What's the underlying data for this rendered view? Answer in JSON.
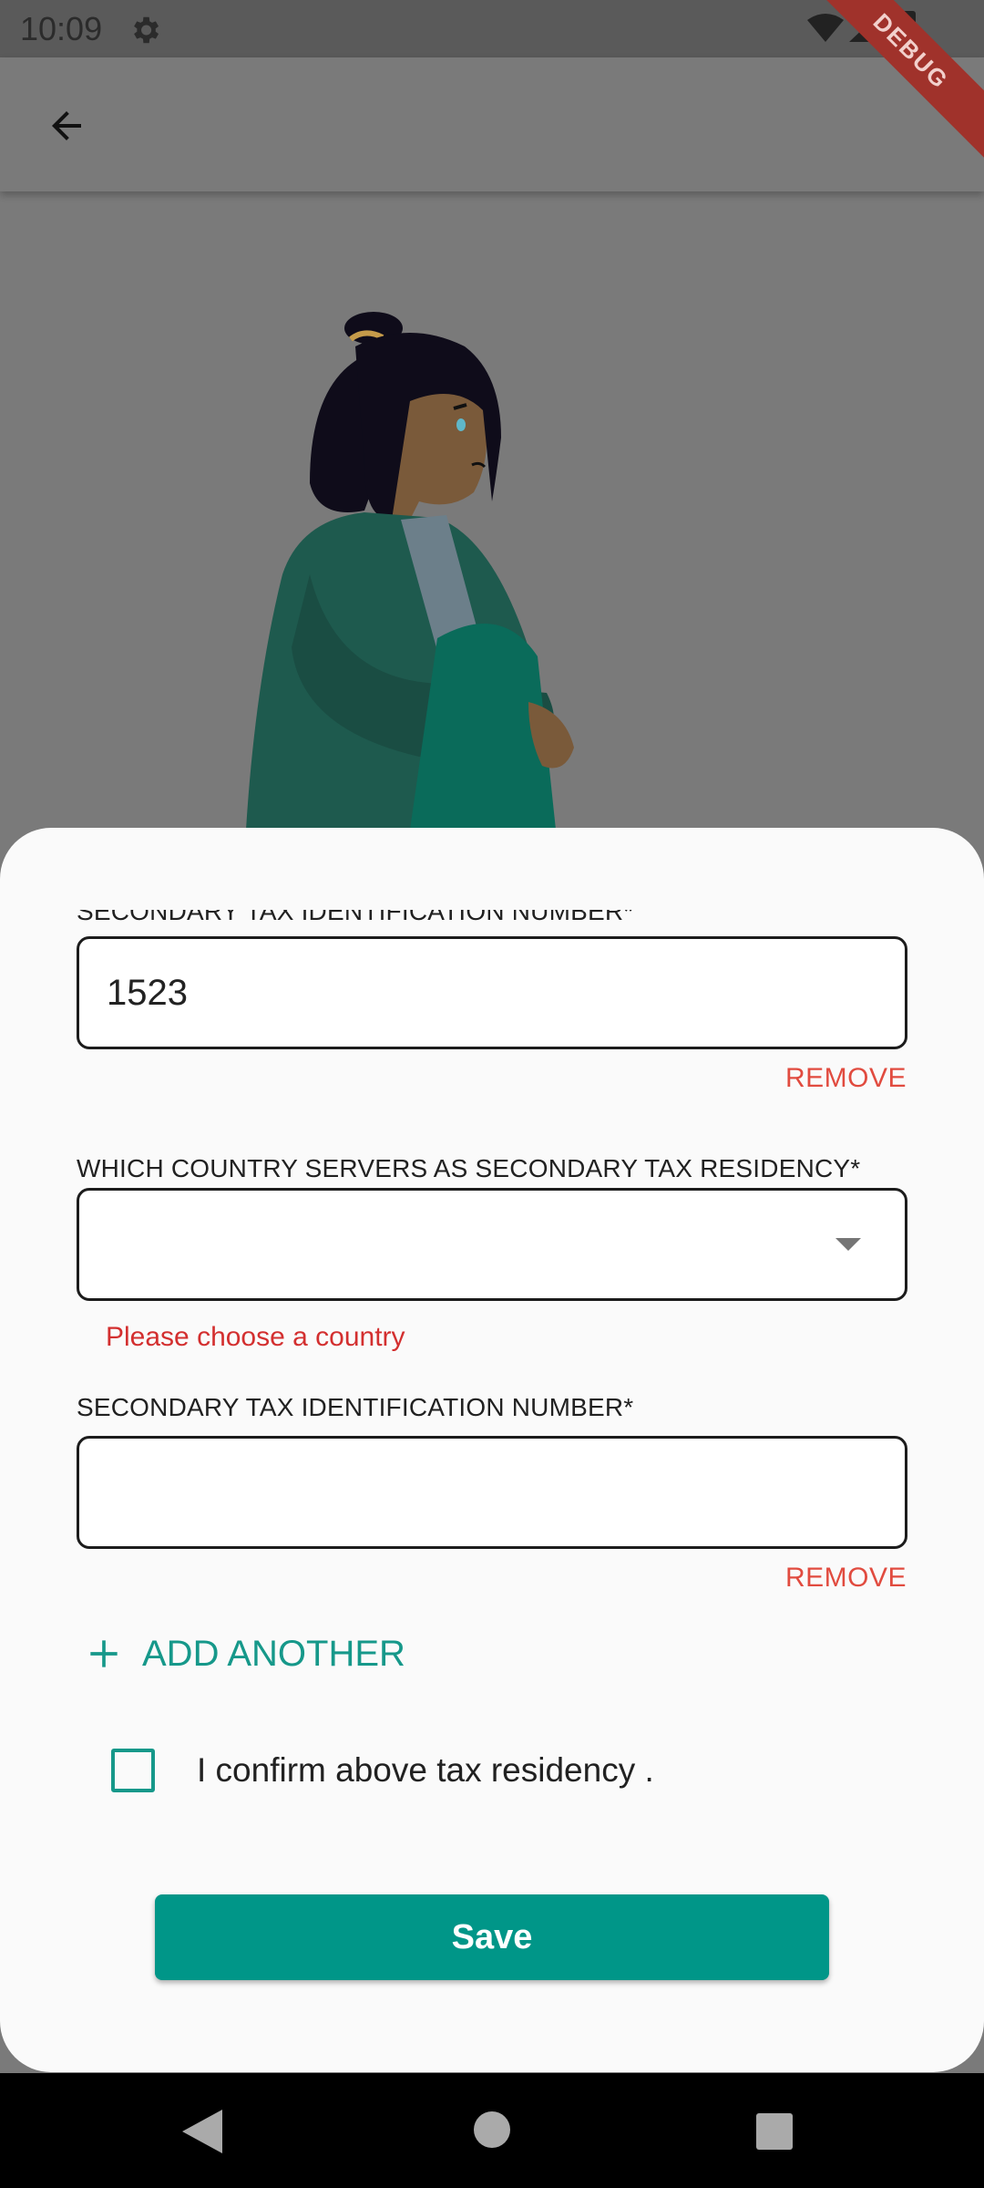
{
  "status_bar": {
    "time": "10:09"
  },
  "debug_banner": "DEBUG",
  "form": {
    "tin_label_top": "SECONDARY TAX IDENTIFICATION NUMBER*",
    "tin_value_top": "1523",
    "remove_top": "REMOVE",
    "country_label": "WHICH COUNTRY SERVERS AS SECONDARY TAX RESIDENCY*",
    "country_value": "",
    "country_error": "Please choose a country",
    "tin_label_bottom": "SECONDARY TAX IDENTIFICATION NUMBER*",
    "tin_value_bottom": "",
    "remove_bottom": "REMOVE",
    "add_another": "ADD ANOTHER",
    "confirm_text": "I confirm above tax residency .",
    "confirm_checked": false,
    "save_label": "Save"
  },
  "colors": {
    "accent": "#009688",
    "error": "#d32f2f",
    "remove": "#e14b3f"
  }
}
